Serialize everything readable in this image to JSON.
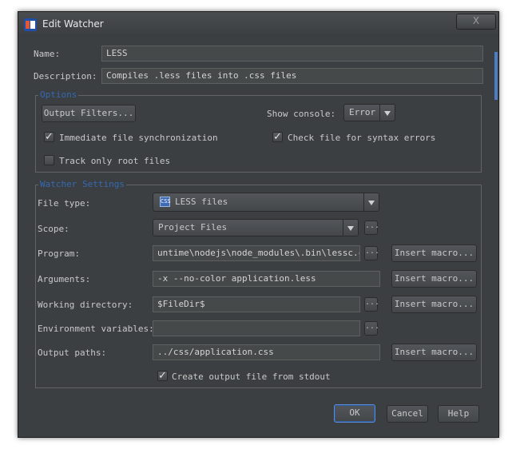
{
  "window": {
    "title": "Edit Watcher",
    "close_symbol": "X"
  },
  "name": {
    "label": "Name:",
    "value": "LESS"
  },
  "description": {
    "label": "Description:",
    "value": "Compiles .less files into .css files"
  },
  "options": {
    "legend": "Options",
    "output_filters_label": "Output Filters...",
    "show_console_label": "Show console:",
    "show_console_value": "Error",
    "immediate_sync_label": "Immediate file synchronization",
    "immediate_sync_checked": true,
    "check_syntax_label": "Check file for syntax errors",
    "check_syntax_checked": true,
    "track_root_label": "Track only root files",
    "track_root_checked": false
  },
  "watcher": {
    "legend": "Watcher Settings",
    "file_type_label": "File type:",
    "file_type_value": "LESS files",
    "file_type_icon_text": "CSS",
    "scope_label": "Scope:",
    "scope_value": "Project Files",
    "program_label": "Program:",
    "program_value": "untime\\nodejs\\node_modules\\.bin\\lessc.cmd",
    "arguments_label": "Arguments:",
    "arguments_value": "-x --no-color application.less",
    "working_dir_label": "Working directory:",
    "working_dir_value": "$FileDir$",
    "env_label": "Environment variables:",
    "env_value": "",
    "output_paths_label": "Output paths:",
    "output_paths_value": "../css/application.css",
    "create_stdout_label": "Create output file from stdout",
    "create_stdout_checked": true,
    "insert_macro_label": "Insert macro...",
    "browse_label": "..."
  },
  "footer": {
    "ok_label": "OK",
    "cancel_label": "Cancel",
    "help_label": "Help"
  },
  "colors": {
    "background": "#3c3f41",
    "legend": "#3569b3",
    "field": "#45494a"
  }
}
